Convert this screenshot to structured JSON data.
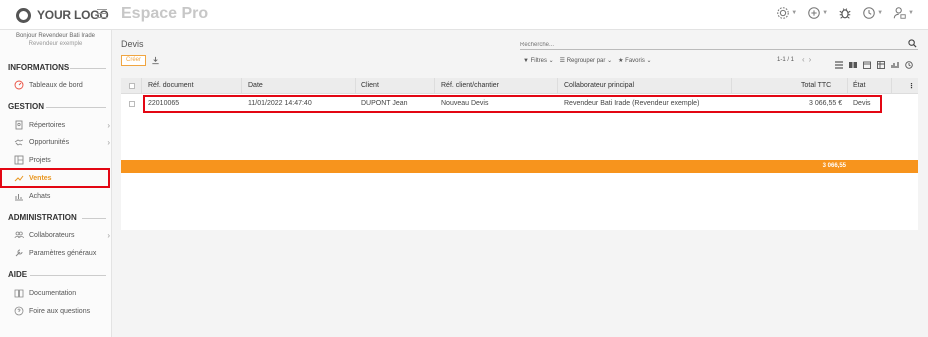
{
  "brand": {
    "logo_text": "YOUR LOGO",
    "app_title": "Espace Pro"
  },
  "user": {
    "name": "Bonjour Revendeur Bati Irade",
    "org": "Revendeur exemple"
  },
  "sidebar": {
    "sections": [
      {
        "label": "INFORMATIONS"
      },
      {
        "label": "GESTION"
      },
      {
        "label": "ADMINISTRATION"
      },
      {
        "label": "AIDE"
      }
    ],
    "items": [
      {
        "label": "Tableaux de bord"
      },
      {
        "label": "Répertoires"
      },
      {
        "label": "Opportunités"
      },
      {
        "label": "Projets"
      },
      {
        "label": "Ventes"
      },
      {
        "label": "Achats"
      },
      {
        "label": "Collaborateurs"
      },
      {
        "label": "Paramètres généraux"
      },
      {
        "label": "Documentation"
      },
      {
        "label": "Foire aux questions"
      }
    ]
  },
  "main": {
    "title": "Devis",
    "search_placeholder": "Recherche...",
    "create_label": "Créer",
    "filters": {
      "filters_label": "Filtres",
      "group_label": "Regrouper par",
      "favorites_label": "Favoris"
    },
    "pager": "1-1 / 1",
    "columns": [
      "Réf. document",
      "Date",
      "Client",
      "Réf. client/chantier",
      "Collaborateur principal",
      "Total TTC",
      "État"
    ],
    "rows": [
      {
        "ref": "22010065",
        "date": "11/01/2022 14:47:40",
        "client": "DUPONT Jean",
        "ref_client": "Nouveau Devis",
        "collaborator": "Revendeur Bati Irade (Revendeur exemple)",
        "total": "3 066,55 €",
        "state": "Devis"
      }
    ],
    "total_sum": "3 066,55"
  },
  "colors": {
    "accent": "#f7941d",
    "highlight": "#e30613",
    "active": "#e9961f"
  }
}
